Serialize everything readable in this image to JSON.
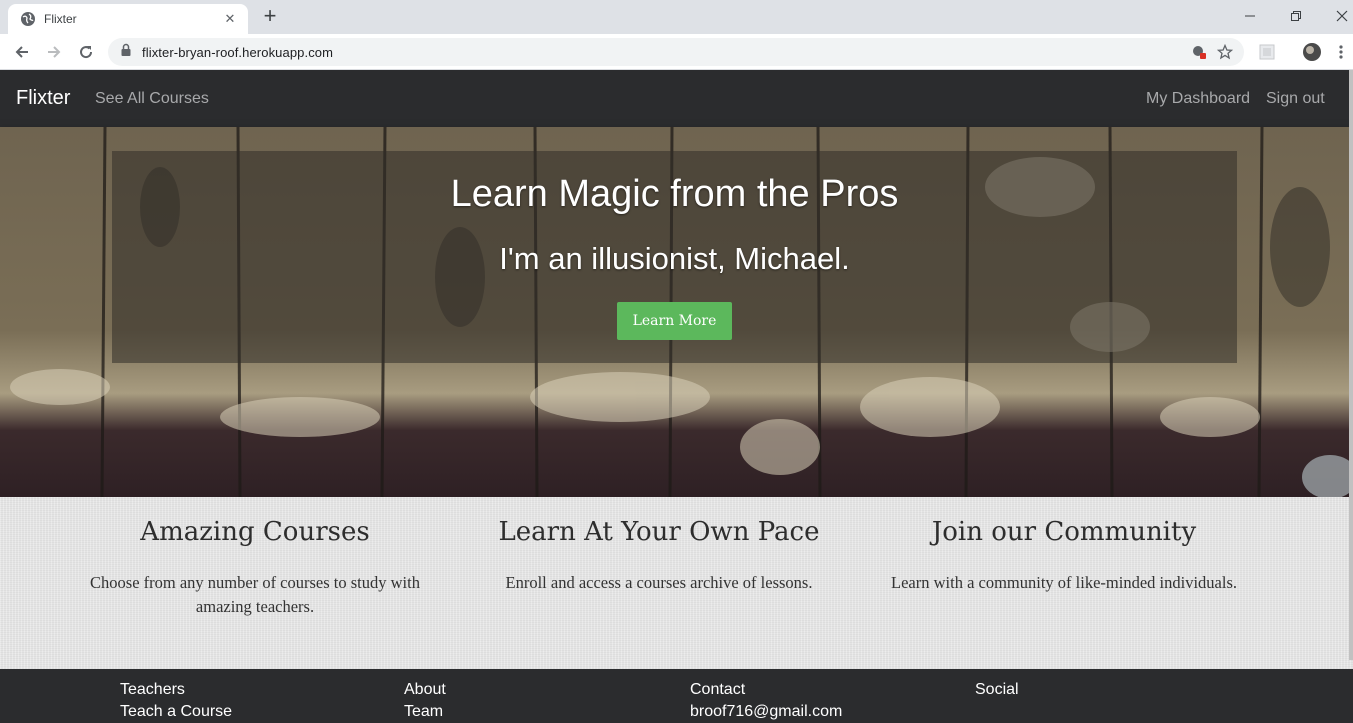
{
  "browser": {
    "tab_title": "Flixter",
    "tab_close": "✕",
    "new_tab": "+",
    "url": "flixter-bryan-roof.herokuapp.com"
  },
  "site": {
    "brand": "Flixter",
    "nav_left": [
      "See All Courses"
    ],
    "nav_right": [
      "My Dashboard",
      "Sign out"
    ]
  },
  "hero": {
    "title": "Learn Magic from the Pros",
    "subtitle": "I'm an illusionist, Michael.",
    "button": "Learn More"
  },
  "features": [
    {
      "title": "Amazing Courses",
      "text": "Choose from any number of courses to study with amazing teachers."
    },
    {
      "title": "Learn At Your Own Pace",
      "text": "Enroll and access a courses archive of lessons."
    },
    {
      "title": "Join our Community",
      "text": "Learn with a community of like-minded individuals."
    }
  ],
  "footer": [
    {
      "head": "Teachers",
      "link": "Teach a Course"
    },
    {
      "head": "About",
      "link": "Team"
    },
    {
      "head": "Contact",
      "link": "broof716@gmail.com"
    },
    {
      "head": "Social",
      "link": ""
    }
  ],
  "colors": {
    "nav_bg": "#2b2c2e",
    "button_green": "#5cb85c",
    "footer_bg": "#2b2c2e"
  }
}
